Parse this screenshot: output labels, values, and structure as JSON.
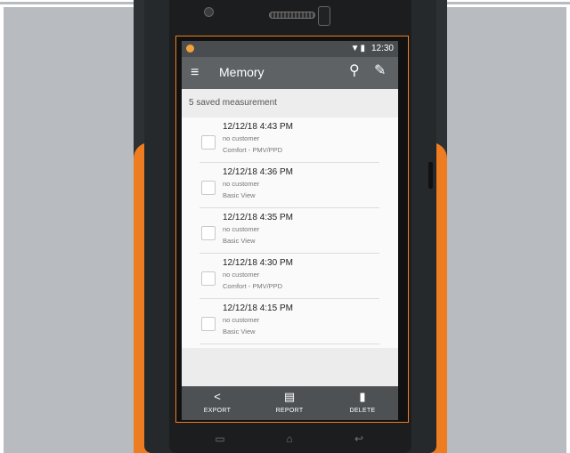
{
  "status_bar": {
    "time": "12:30",
    "icons": "▼▮"
  },
  "app_bar": {
    "title": "Memory",
    "menu_icon": "≡",
    "search_icon": "⚲",
    "edit_icon": "✎"
  },
  "list_header": "5 saved measurement",
  "measurements": [
    {
      "date": "12/12/18 4:43 PM",
      "customer": "no customer",
      "view": "Comfort - PMV/PPD"
    },
    {
      "date": "12/12/18 4:36 PM",
      "customer": "no customer",
      "view": "Basic View"
    },
    {
      "date": "12/12/18 4:35 PM",
      "customer": "no customer",
      "view": "Basic View"
    },
    {
      "date": "12/12/18 4:30 PM",
      "customer": "no customer",
      "view": "Comfort - PMV/PPD"
    },
    {
      "date": "12/12/18 4:15 PM",
      "customer": "no customer",
      "view": "Basic View"
    }
  ],
  "actions": {
    "export": {
      "label": "EXPORT",
      "icon": "<"
    },
    "report": {
      "label": "REPORT",
      "icon": "▤"
    },
    "delete": {
      "label": "DELETE",
      "icon": "▮"
    }
  },
  "nav": {
    "recent": "▭",
    "home": "⌂",
    "back": "↩"
  },
  "colors": {
    "accent": "#ee7d22",
    "app_bar": "#5f6265",
    "action_bar": "#4e5154"
  }
}
